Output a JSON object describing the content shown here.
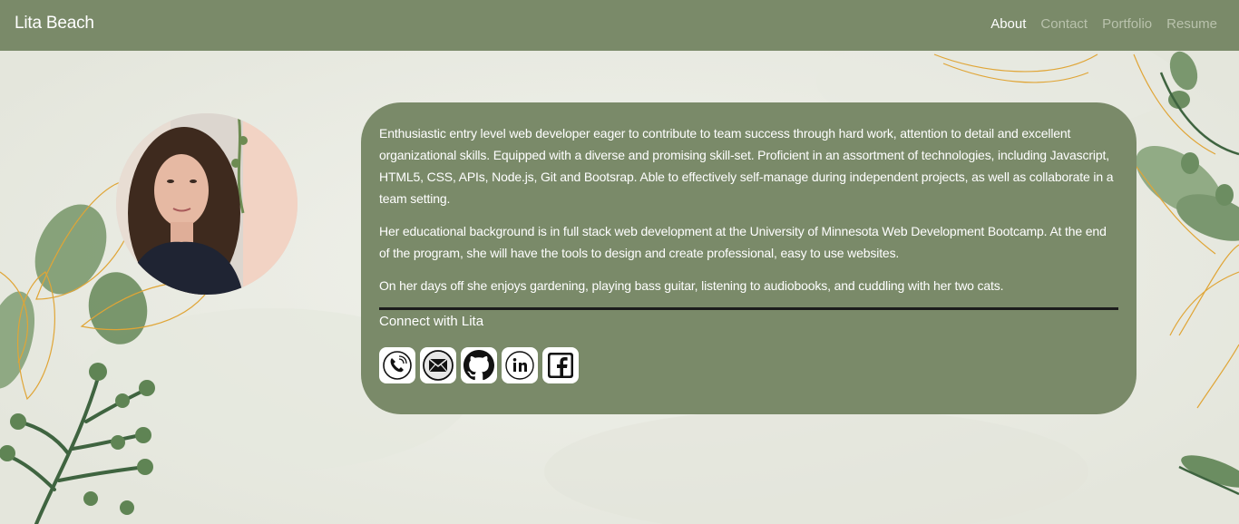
{
  "navbar": {
    "brand": "Lita Beach",
    "links": [
      {
        "label": "About",
        "active": true
      },
      {
        "label": "Contact",
        "active": false
      },
      {
        "label": "Portfolio",
        "active": false
      },
      {
        "label": "Resume",
        "active": false
      }
    ]
  },
  "profile": {
    "photo_alt": "Lita Beach"
  },
  "about": {
    "paragraphs": [
      "Enthusiastic entry level web developer eager to contribute to team success through hard work, attention to detail and excellent organizational skills. Equipped with a diverse and promising skill-set. Proficient in an assortment of technologies, including Javascript, HTML5, CSS, APIs, Node.js, Git and Bootsrap. Able to effectively self-manage during independent projects, as well as collaborate in a team setting.",
      "Her educational background is in full stack web development at the University of Minnesota Web Development Bootcamp. At the end of the program, she will have the tools to design and create professional, easy to use websites.",
      "On her days off she enjoys gardening, playing bass guitar, listening to audiobooks, and cuddling with her two cats."
    ],
    "connect_label": "Connect with Lita"
  },
  "social_icons": [
    "phone-icon",
    "email-icon",
    "github-icon",
    "linkedin-icon",
    "facebook-icon"
  ],
  "colors": {
    "nav_bg": "#7a8a69",
    "card_bg": "#7a8a69",
    "page_bg": "#ecede6",
    "leaf_green": "#6f8f63",
    "leaf_gold": "#e0a536",
    "stem_green": "#3f6440"
  }
}
